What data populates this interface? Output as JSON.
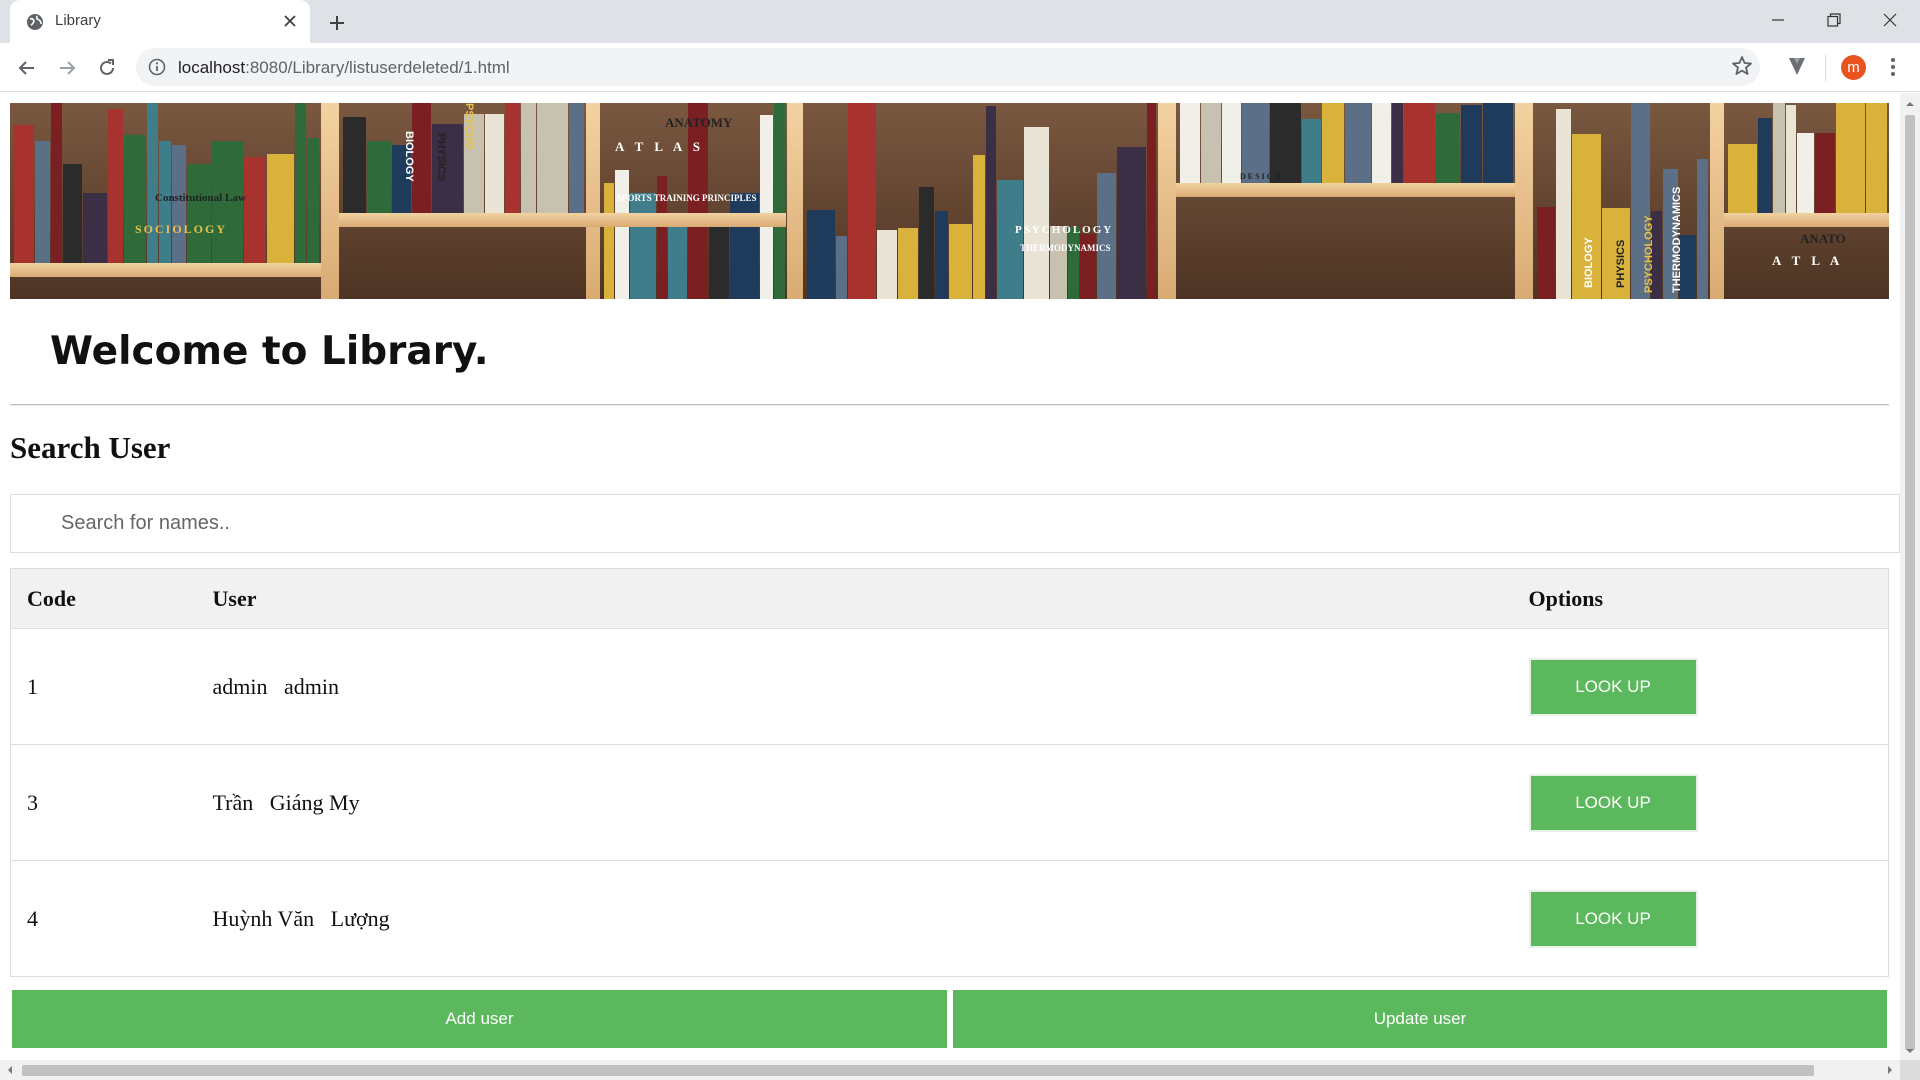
{
  "browser": {
    "tab_title": "Library",
    "url_host": "localhost",
    "url_rest": ":8080/Library/listuserdeleted/1.html",
    "avatar_letter": "m",
    "icons": [
      "globe-icon",
      "close-icon",
      "plus-icon",
      "minimize-icon",
      "restore-icon",
      "window-close-icon",
      "back-icon",
      "forward-icon",
      "reload-icon",
      "info-icon",
      "star-icon",
      "extension-icon",
      "kebab-menu-icon"
    ]
  },
  "page": {
    "welcome": "Welcome to Library.",
    "search_title": "Search User",
    "search_placeholder": "Search for names..",
    "table": {
      "headers": {
        "code": "Code",
        "user": "User",
        "options": "Options"
      },
      "rows": [
        {
          "code": "1",
          "user": "admin   admin",
          "action": "LOOK UP"
        },
        {
          "code": "3",
          "user": "Trần   Giáng My",
          "action": "LOOK UP"
        },
        {
          "code": "4",
          "user": "Huỳnh Văn   Lượng",
          "action": "LOOK UP"
        }
      ]
    },
    "add_user": "Add user",
    "update_user": "Update user",
    "banner_labels": [
      "BIOLOGY",
      "PHYSICS",
      "PSYCHO",
      "ANATOMY",
      "A T L A S",
      "SPORTS TRAINING PRINCIPLES",
      "Constitutional Law",
      "SOCIOLOGY",
      "PSYCHOLOGY",
      "THERMODYNAMICS",
      "DESIGN",
      "BIOLOGY",
      "PHYSICS",
      "PSYCHOLOGY",
      "THERMODYNAMICS",
      "ANATO",
      "A T L A"
    ]
  },
  "colors": {
    "accent_green": "#5cb85c",
    "tabstrip": "#dee1e6",
    "avatar": "#e8531f"
  }
}
